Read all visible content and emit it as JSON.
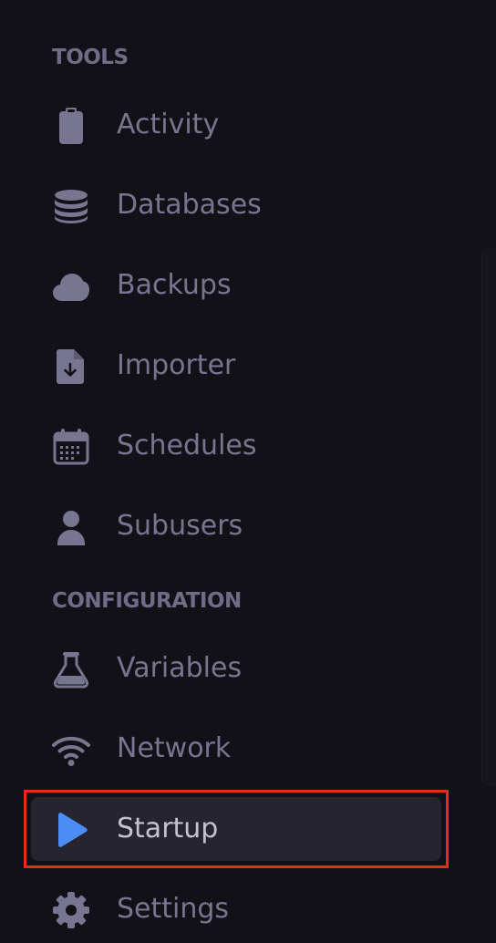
{
  "sections": [
    {
      "heading": "TOOLS",
      "items": [
        {
          "label": "Activity",
          "icon": "clipboard-icon"
        },
        {
          "label": "Databases",
          "icon": "database-icon"
        },
        {
          "label": "Backups",
          "icon": "cloud-icon"
        },
        {
          "label": "Importer",
          "icon": "file-import-icon"
        },
        {
          "label": "Schedules",
          "icon": "calendar-icon"
        },
        {
          "label": "Subusers",
          "icon": "user-icon"
        }
      ]
    },
    {
      "heading": "CONFIGURATION",
      "items": [
        {
          "label": "Variables",
          "icon": "flask-icon"
        },
        {
          "label": "Network",
          "icon": "wifi-icon"
        },
        {
          "label": "Startup",
          "icon": "play-icon",
          "active": true
        },
        {
          "label": "Settings",
          "icon": "gear-icon"
        }
      ]
    }
  ],
  "colors": {
    "background": "#121118",
    "text": "#77758f",
    "heading": "#6e6c87",
    "active_text": "#c3c2d3",
    "active_background": "#25242f",
    "active_icon": "#4c8df5",
    "highlight": "#f0281c"
  }
}
